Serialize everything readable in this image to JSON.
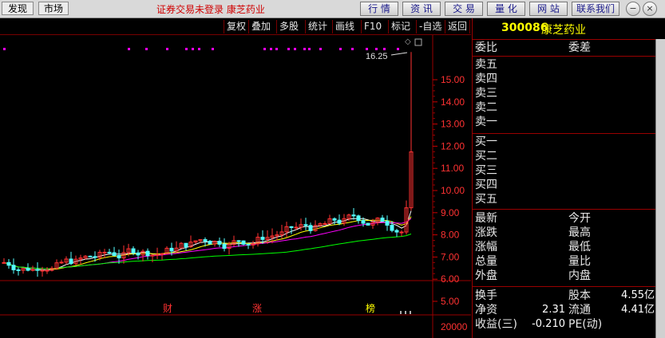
{
  "topbar": {
    "left_tabs": [
      "发现",
      "市场"
    ],
    "title": "证券交易未登录  康芝药业",
    "nav": [
      "行 情",
      "资 讯",
      "交 易",
      "量 化",
      "网 站",
      "联系我们"
    ]
  },
  "chart_toolbar": [
    "复权",
    "叠加",
    "多股",
    "统计",
    "画线",
    "F10",
    "标记",
    "-自选",
    "返回"
  ],
  "price_axis": [
    "15.00",
    "14.00",
    "13.00",
    "12.00",
    "11.00",
    "10.00",
    "9.00",
    "8.00",
    "7.00",
    "6.00",
    "5.00"
  ],
  "volume_axis": "20000",
  "annotation_high": "16.25",
  "markers": [
    "财",
    "涨",
    "榜"
  ],
  "panel": {
    "code": "300086",
    "name": "康芝药业",
    "header": [
      "委比",
      "委差"
    ],
    "sells": [
      "卖五",
      "卖四",
      "卖三",
      "卖二",
      "卖一"
    ],
    "buys": [
      "买一",
      "买二",
      "买三",
      "买四",
      "买五"
    ],
    "quote_left": [
      "最新",
      "涨跌",
      "涨幅",
      "总量",
      "外盘"
    ],
    "quote_right": [
      "今开",
      "最高",
      "最低",
      "量比",
      "内盘"
    ],
    "finance": [
      {
        "label": "换手",
        "label2": "股本",
        "value2": "4.55亿"
      },
      {
        "label": "净资",
        "value": "2.31",
        "label2": "流通",
        "value2": "4.41亿"
      },
      {
        "label": "收益(三)",
        "value": "-0.210",
        "label2": "PE(动)",
        "value2": ""
      }
    ]
  },
  "colors": {
    "up": "#ff3232",
    "down": "#54ffff",
    "ma1": "#ffffff",
    "ma2": "#ffff00",
    "ma3": "#ff00ff",
    "ma4": "#00ff00"
  }
}
